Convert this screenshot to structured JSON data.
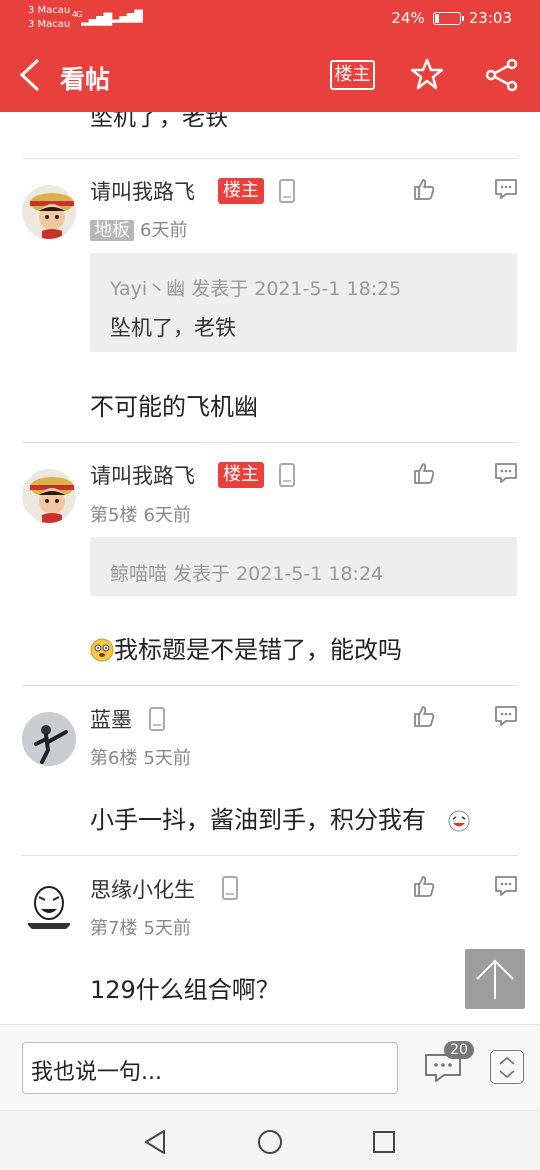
{
  "status_bar": {
    "carrier1": "3 Macau",
    "carrier2": "3 Macau",
    "net1": "4G",
    "battery": "24%",
    "battery_level": 0.24,
    "time": "23:03"
  },
  "header": {
    "title": "看帖",
    "owner_label": "楼主",
    "icons": [
      "back-icon",
      "star-icon",
      "share-icon"
    ]
  },
  "partial_text": "坠机了，老铁",
  "posts": [
    {
      "author": "请叫我路飞",
      "owner_badge": "楼主",
      "floor": "地板",
      "time": "6天前",
      "quote_meta": "Yayi丶幽 发表于 2021-5-1 18:25",
      "quote_text": "坠机了，老铁",
      "text": "不可能的飞机幽"
    },
    {
      "author": "请叫我路飞",
      "owner_badge": "楼主",
      "floor": "第5楼",
      "time": "6天前",
      "quote_meta": "鲸喵喵 发表于 2021-5-1 18:24",
      "text": "我标题是不是错了，能改吗"
    },
    {
      "author": "蓝墨",
      "floor": "第6楼",
      "time": "5天前",
      "text": "小手一抖，酱油到手，积分我有"
    },
    {
      "author": "思缘小化生",
      "floor": "第7楼",
      "time": "5天前",
      "text": "129什么组合啊？"
    }
  ],
  "bottom": {
    "reply_placeholder": "我也说一句...",
    "comment_count": "20"
  },
  "colors": {
    "brand": "#e8403c",
    "text": "#222222",
    "muted": "#888888"
  }
}
